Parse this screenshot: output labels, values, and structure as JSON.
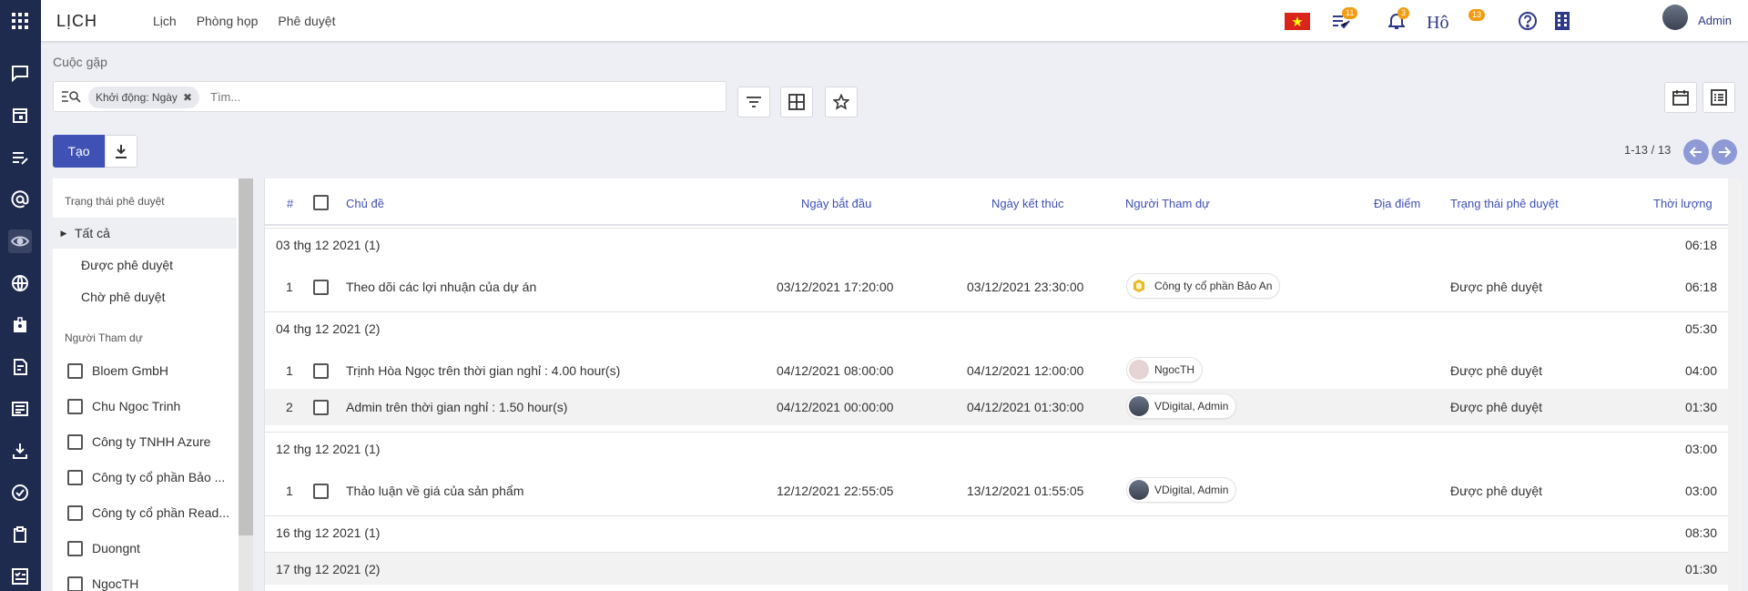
{
  "app": {
    "title": "LỊCH",
    "menu": [
      "Lịch",
      "Phòng họp",
      "Phê duyệt"
    ]
  },
  "topbar": {
    "activity_badge": "11",
    "notif_badge": "3",
    "script_label": "Hô",
    "extra_badge": "13",
    "user_name": "Admin"
  },
  "rail_icons": [
    "apps-icon",
    "chat-icon",
    "calendar-icon",
    "notes-icon",
    "at-icon",
    "eye-icon",
    "globe-icon",
    "badge-icon",
    "edit-doc-icon",
    "news-icon",
    "import-icon",
    "check-circle-icon",
    "clipboard-icon",
    "checklist-icon"
  ],
  "breadcrumb": "Cuộc gặp",
  "search": {
    "facet_label": "Khởi động: Ngày",
    "placeholder": "Tìm..."
  },
  "buttons": {
    "create": "Tạo"
  },
  "pager": "1-13 / 13",
  "sidepanel": {
    "approval_heading": "Trạng thái phê duyệt",
    "approval_items": [
      "Tất cả",
      "Được phê duyệt",
      "Chờ phê duyệt"
    ],
    "attendee_heading": "Người Tham dự",
    "attendees": [
      "Bloem GmbH",
      "Chu Ngoc Trinh",
      "Công ty TNHH Azure",
      "Công ty cổ phần Bảo ...",
      "Công ty cổ phần Read...",
      "Duongnt",
      "NgocTH"
    ]
  },
  "table": {
    "columns": [
      "#",
      "Chủ đề",
      "Ngày bắt đầu",
      "Ngày kết thúc",
      "Người Tham dự",
      "Địa điểm",
      "Trạng thái phê duyệt",
      "Thời lượng"
    ],
    "groups": [
      {
        "label": "03 thg 12 2021 (1)",
        "duration": "06:18"
      },
      {
        "label": "04 thg 12 2021 (2)",
        "duration": "05:30"
      },
      {
        "label": "12 thg 12 2021 (1)",
        "duration": "03:00"
      },
      {
        "label": "16 thg 12 2021 (1)",
        "duration": "08:30"
      },
      {
        "label": "17 thg 12 2021 (2)",
        "duration": "01:30"
      }
    ],
    "rows": [
      {
        "num": "1",
        "subject": "Theo dõi các lợi nhuận của dự án",
        "start": "03/12/2021 17:20:00",
        "end": "03/12/2021 23:30:00",
        "attendee": "Công ty cổ phần Bảo An",
        "status": "Được phê duyệt",
        "duration": "06:18"
      },
      {
        "num": "1",
        "subject": "Trịnh Hòa Ngọc trên thời gian nghỉ : 4.00 hour(s)",
        "start": "04/12/2021 08:00:00",
        "end": "04/12/2021 12:00:00",
        "attendee": "NgocTH",
        "status": "Được phê duyệt",
        "duration": "04:00"
      },
      {
        "num": "2",
        "subject": "Admin trên thời gian nghỉ : 1.50 hour(s)",
        "start": "04/12/2021 00:00:00",
        "end": "04/12/2021 01:30:00",
        "attendee": "VDigital, Admin",
        "status": "Được phê duyệt",
        "duration": "01:30"
      },
      {
        "num": "1",
        "subject": "Thảo luận về giá của sản phẩm",
        "start": "12/12/2021 22:55:05",
        "end": "13/12/2021 01:55:05",
        "attendee": "VDigital, Admin",
        "status": "Được phê duyệt",
        "duration": "03:00"
      }
    ]
  },
  "colors": {
    "rail": "#1e2a4e",
    "primary": "#3f51b5",
    "badge": "#f39c12"
  }
}
